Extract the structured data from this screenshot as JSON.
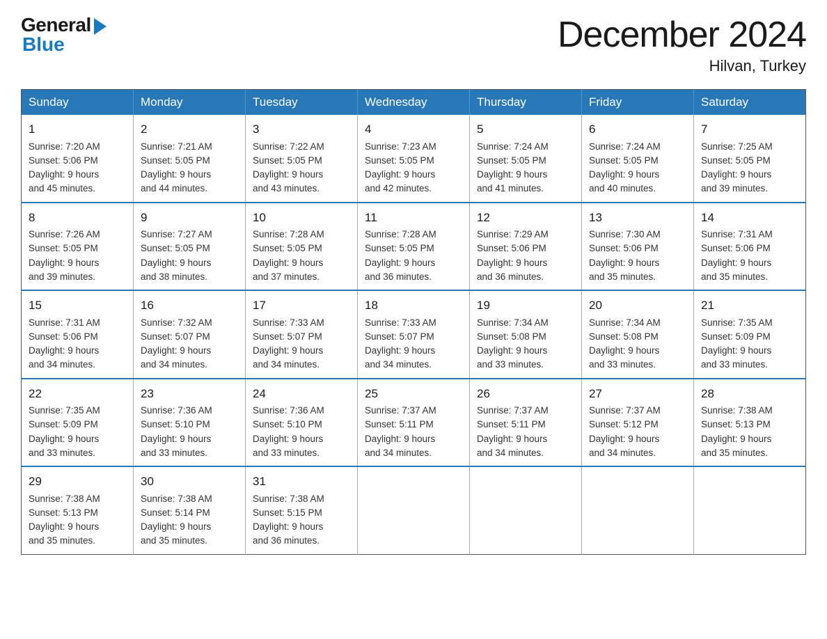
{
  "header": {
    "logo": {
      "general": "General",
      "blue": "Blue"
    },
    "title": "December 2024",
    "location": "Hilvan, Turkey"
  },
  "days": [
    "Sunday",
    "Monday",
    "Tuesday",
    "Wednesday",
    "Thursday",
    "Friday",
    "Saturday"
  ],
  "weeks": [
    [
      {
        "day": "1",
        "sunrise": "7:20 AM",
        "sunset": "5:06 PM",
        "daylight": "9 hours and 45 minutes."
      },
      {
        "day": "2",
        "sunrise": "7:21 AM",
        "sunset": "5:05 PM",
        "daylight": "9 hours and 44 minutes."
      },
      {
        "day": "3",
        "sunrise": "7:22 AM",
        "sunset": "5:05 PM",
        "daylight": "9 hours and 43 minutes."
      },
      {
        "day": "4",
        "sunrise": "7:23 AM",
        "sunset": "5:05 PM",
        "daylight": "9 hours and 42 minutes."
      },
      {
        "day": "5",
        "sunrise": "7:24 AM",
        "sunset": "5:05 PM",
        "daylight": "9 hours and 41 minutes."
      },
      {
        "day": "6",
        "sunrise": "7:24 AM",
        "sunset": "5:05 PM",
        "daylight": "9 hours and 40 minutes."
      },
      {
        "day": "7",
        "sunrise": "7:25 AM",
        "sunset": "5:05 PM",
        "daylight": "9 hours and 39 minutes."
      }
    ],
    [
      {
        "day": "8",
        "sunrise": "7:26 AM",
        "sunset": "5:05 PM",
        "daylight": "9 hours and 39 minutes."
      },
      {
        "day": "9",
        "sunrise": "7:27 AM",
        "sunset": "5:05 PM",
        "daylight": "9 hours and 38 minutes."
      },
      {
        "day": "10",
        "sunrise": "7:28 AM",
        "sunset": "5:05 PM",
        "daylight": "9 hours and 37 minutes."
      },
      {
        "day": "11",
        "sunrise": "7:28 AM",
        "sunset": "5:05 PM",
        "daylight": "9 hours and 36 minutes."
      },
      {
        "day": "12",
        "sunrise": "7:29 AM",
        "sunset": "5:06 PM",
        "daylight": "9 hours and 36 minutes."
      },
      {
        "day": "13",
        "sunrise": "7:30 AM",
        "sunset": "5:06 PM",
        "daylight": "9 hours and 35 minutes."
      },
      {
        "day": "14",
        "sunrise": "7:31 AM",
        "sunset": "5:06 PM",
        "daylight": "9 hours and 35 minutes."
      }
    ],
    [
      {
        "day": "15",
        "sunrise": "7:31 AM",
        "sunset": "5:06 PM",
        "daylight": "9 hours and 34 minutes."
      },
      {
        "day": "16",
        "sunrise": "7:32 AM",
        "sunset": "5:07 PM",
        "daylight": "9 hours and 34 minutes."
      },
      {
        "day": "17",
        "sunrise": "7:33 AM",
        "sunset": "5:07 PM",
        "daylight": "9 hours and 34 minutes."
      },
      {
        "day": "18",
        "sunrise": "7:33 AM",
        "sunset": "5:07 PM",
        "daylight": "9 hours and 34 minutes."
      },
      {
        "day": "19",
        "sunrise": "7:34 AM",
        "sunset": "5:08 PM",
        "daylight": "9 hours and 33 minutes."
      },
      {
        "day": "20",
        "sunrise": "7:34 AM",
        "sunset": "5:08 PM",
        "daylight": "9 hours and 33 minutes."
      },
      {
        "day": "21",
        "sunrise": "7:35 AM",
        "sunset": "5:09 PM",
        "daylight": "9 hours and 33 minutes."
      }
    ],
    [
      {
        "day": "22",
        "sunrise": "7:35 AM",
        "sunset": "5:09 PM",
        "daylight": "9 hours and 33 minutes."
      },
      {
        "day": "23",
        "sunrise": "7:36 AM",
        "sunset": "5:10 PM",
        "daylight": "9 hours and 33 minutes."
      },
      {
        "day": "24",
        "sunrise": "7:36 AM",
        "sunset": "5:10 PM",
        "daylight": "9 hours and 33 minutes."
      },
      {
        "day": "25",
        "sunrise": "7:37 AM",
        "sunset": "5:11 PM",
        "daylight": "9 hours and 34 minutes."
      },
      {
        "day": "26",
        "sunrise": "7:37 AM",
        "sunset": "5:11 PM",
        "daylight": "9 hours and 34 minutes."
      },
      {
        "day": "27",
        "sunrise": "7:37 AM",
        "sunset": "5:12 PM",
        "daylight": "9 hours and 34 minutes."
      },
      {
        "day": "28",
        "sunrise": "7:38 AM",
        "sunset": "5:13 PM",
        "daylight": "9 hours and 35 minutes."
      }
    ],
    [
      {
        "day": "29",
        "sunrise": "7:38 AM",
        "sunset": "5:13 PM",
        "daylight": "9 hours and 35 minutes."
      },
      {
        "day": "30",
        "sunrise": "7:38 AM",
        "sunset": "5:14 PM",
        "daylight": "9 hours and 35 minutes."
      },
      {
        "day": "31",
        "sunrise": "7:38 AM",
        "sunset": "5:15 PM",
        "daylight": "9 hours and 36 minutes."
      },
      null,
      null,
      null,
      null
    ]
  ],
  "labels": {
    "sunrise": "Sunrise:",
    "sunset": "Sunset:",
    "daylight": "Daylight:"
  }
}
